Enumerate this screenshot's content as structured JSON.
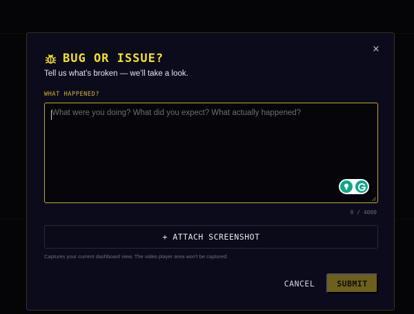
{
  "dialog": {
    "icon": "bug-icon",
    "title": "BUG OR ISSUE?",
    "subtitle": "Tell us what’s broken — we’ll take a look.",
    "close_icon": "close-icon",
    "close_label": "×"
  },
  "field": {
    "label": "WHAT HAPPENED?",
    "value": "",
    "placeholder": "What were you doing? What did you expect? What actually happened?",
    "counter": "0 / 4000"
  },
  "grammarly": {
    "icons": [
      "lightbulb-icon",
      "grammarly-g-icon"
    ]
  },
  "attach": {
    "label": "+ ATTACH SCREENSHOT",
    "hint": "Captures your current dashboard view. The video player area won't be captured."
  },
  "actions": {
    "cancel_label": "CANCEL",
    "submit_label": "SUBMIT"
  },
  "colors": {
    "accent": "#f4e12a",
    "label": "#d6b72c",
    "submit_bg": "#6d5f1c",
    "modal_bg": "#0b0b1c",
    "grammarly_green": "#12a68a"
  }
}
